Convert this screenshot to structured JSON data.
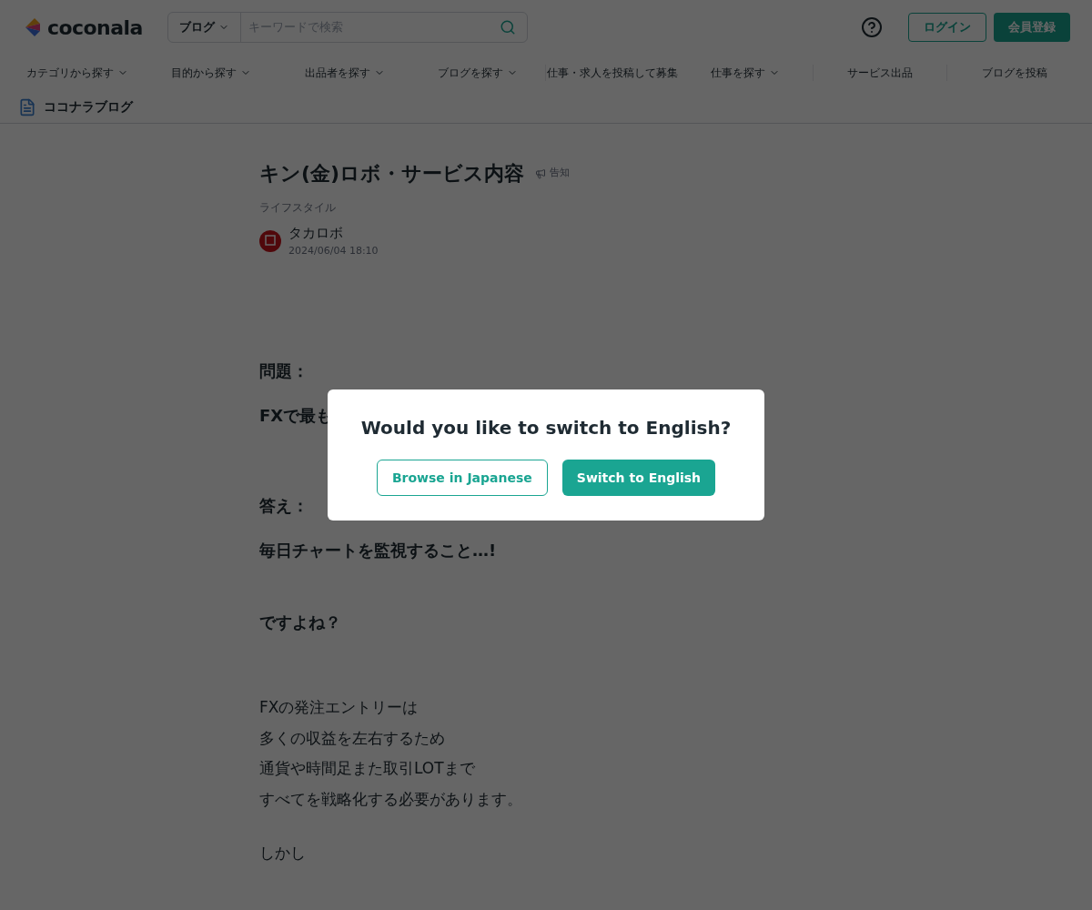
{
  "header": {
    "logo": "coconala",
    "search": {
      "scope": "ブログ",
      "placeholder": "キーワードで検索"
    },
    "login": "ログイン",
    "signup": "会員登録"
  },
  "nav": [
    {
      "label": "カテゴリから探す",
      "dropdown": true
    },
    {
      "label": "目的から探す",
      "dropdown": true
    },
    {
      "label": "出品者を探す",
      "dropdown": true
    },
    {
      "label": "ブログを探す",
      "dropdown": true
    },
    {
      "label": "仕事・求人を投稿して募集",
      "dropdown": false
    },
    {
      "label": "仕事を探す",
      "dropdown": true
    },
    {
      "label": "サービス出品",
      "dropdown": false
    },
    {
      "label": "ブログを投稿",
      "dropdown": false
    }
  ],
  "breadcrumb": "ココナラブログ",
  "article": {
    "title": "キン(金)ロボ・サービス内容",
    "notice": "告知",
    "category": "ライフスタイル",
    "author": "タカロボ",
    "date": "2024/06/04 18:10",
    "paragraphs": [
      {
        "bold": true,
        "lines": [
          "問題："
        ]
      },
      {
        "bold": true,
        "lines": [
          "FXで最も"
        ]
      },
      {
        "bold": true,
        "lines": [
          "答え："
        ]
      },
      {
        "bold": true,
        "lines": [
          "毎日チャートを監視すること…!"
        ]
      },
      {
        "bold": true,
        "lines": [
          "ですよね？"
        ]
      },
      {
        "bold": false,
        "lines": [
          "FXの発注エントリーは",
          "多くの収益を左右するため",
          "通貨や時間足また取引LOTまで",
          "すべてを戦略化する必要があります。"
        ]
      },
      {
        "bold": false,
        "lines": [
          "しかし"
        ]
      }
    ]
  },
  "dialog": {
    "title": "Would you like to switch to English?",
    "buttons": [
      {
        "label": "Browse in Japanese",
        "kind": "outline"
      },
      {
        "label": "Switch to English",
        "kind": "filled"
      }
    ]
  }
}
